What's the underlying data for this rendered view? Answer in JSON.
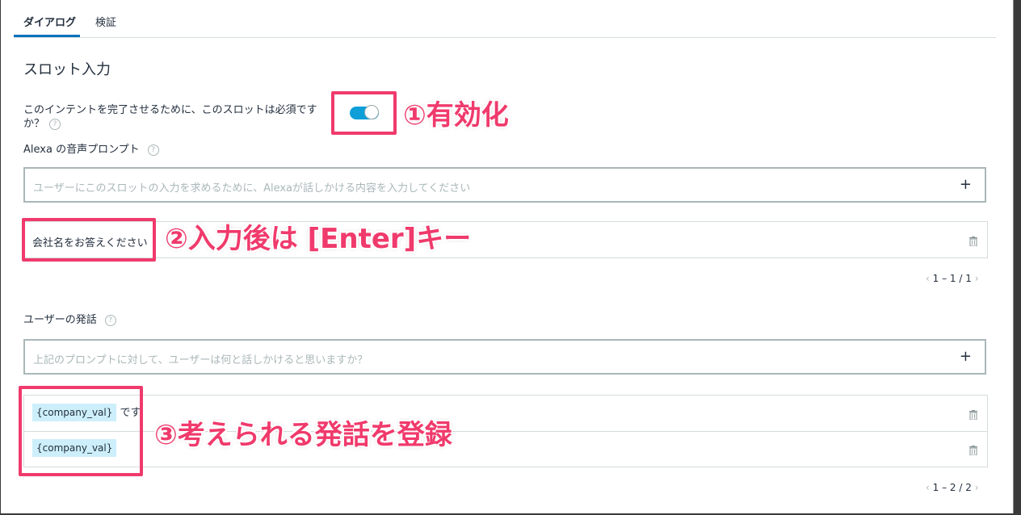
{
  "tabs": [
    {
      "label": "ダイアログ",
      "active": true
    },
    {
      "label": "検証",
      "active": false
    }
  ],
  "section_title": "スロット入力",
  "required_question": {
    "line1": "このインテントを完了させるために、このスロットは必須です",
    "line2": "か？",
    "toggle_on": true
  },
  "prompt_section": {
    "label": "Alexa の音声プロンプト",
    "placeholder": "ユーザーにこのスロットの入力を求めるために、Alexaが話しかける内容を入力してください",
    "add_label": "+",
    "items": [
      "会社名をお答えください"
    ],
    "pager": "1 – 1 / 1"
  },
  "utterance_section": {
    "label": "ユーザーの発話",
    "placeholder": "上記のプロンプトに対して、ユーザーは何と話しかけると思いますか？",
    "add_label": "+",
    "items": [
      {
        "slot": "{company_val}",
        "suffix": "です"
      },
      {
        "slot": "{company_val}",
        "suffix": ""
      }
    ],
    "pager": "1 – 2 / 2"
  },
  "help_glyph": "?",
  "pager_prev": "‹",
  "pager_next": "›",
  "annotations": {
    "step1": "①有効化",
    "step2": "②入力後は [Enter]キー",
    "step3": "③考えられる発話を登録"
  },
  "colors": {
    "accent": "#0073bb",
    "toggle": "#0e9fd8",
    "slot_bg": "#cdeffb",
    "annotation": "#f03a6c"
  }
}
